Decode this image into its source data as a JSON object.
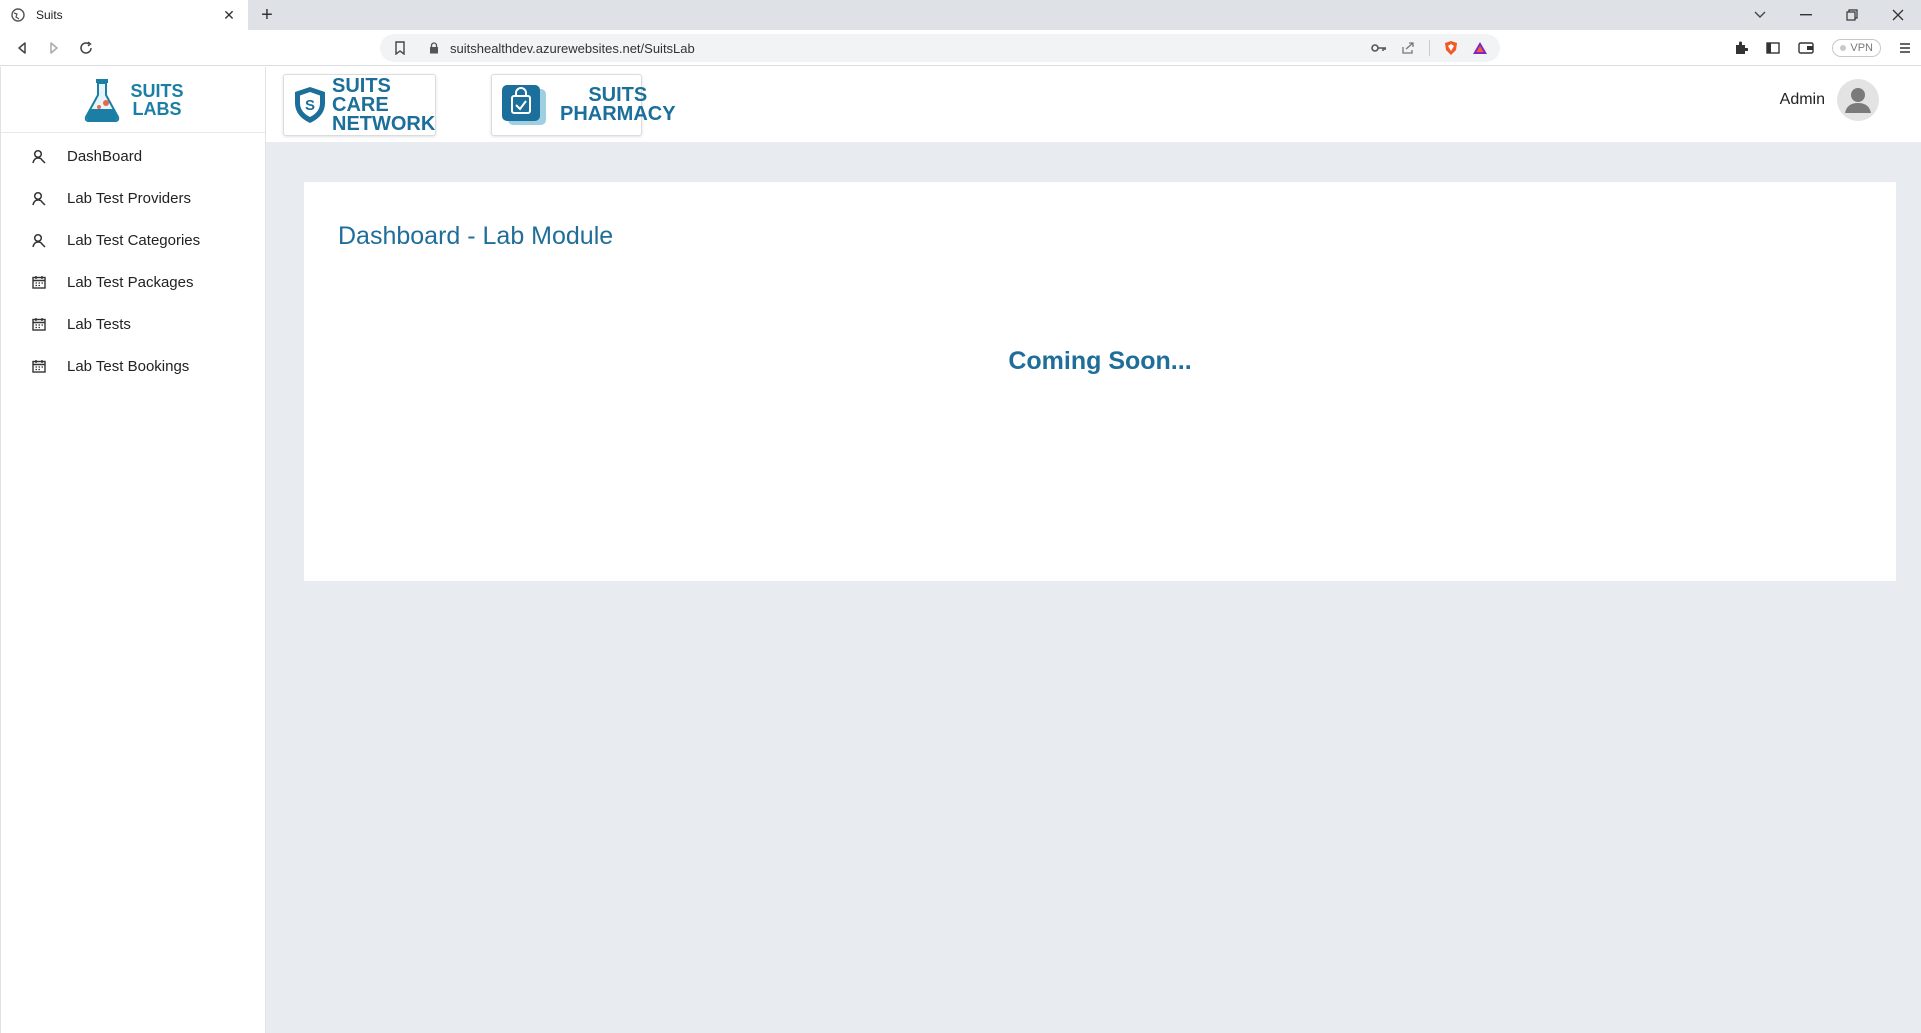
{
  "browser": {
    "tab_title": "Suits",
    "new_tab": "+",
    "url": "suitshealthdev.azurewebsites.net/SuitsLab",
    "vpn_label": "VPN"
  },
  "brand": {
    "line1": "SUITS",
    "line2": "LABS"
  },
  "sidebar": {
    "items": [
      {
        "label": "DashBoard",
        "icon": "user-icon"
      },
      {
        "label": "Lab Test Providers",
        "icon": "user-icon"
      },
      {
        "label": "Lab Test Categories",
        "icon": "user-icon"
      },
      {
        "label": "Lab Test Packages",
        "icon": "calendar-icon"
      },
      {
        "label": "Lab Tests",
        "icon": "calendar-icon"
      },
      {
        "label": "Lab Test Bookings",
        "icon": "calendar-icon"
      }
    ]
  },
  "header": {
    "partner1_line1": "SUITS CARE",
    "partner1_line2": "NETWORK",
    "partner2_line1": "SUITS",
    "partner2_line2": "PHARMACY",
    "user_name": "Admin"
  },
  "main": {
    "title": "Dashboard - Lab Module",
    "message": "Coming Soon..."
  },
  "colors": {
    "accent": "#1f6e9a",
    "background": "#e8ebef"
  }
}
